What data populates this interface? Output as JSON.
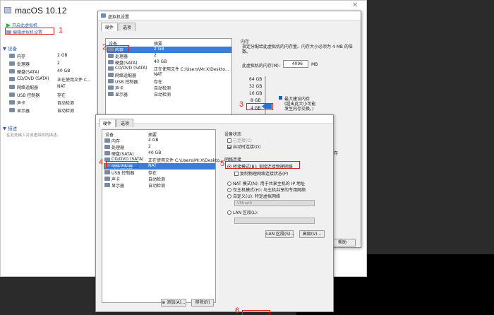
{
  "library": {
    "title": "macOS 10.12",
    "actions": [
      {
        "label": "开启此虚拟机",
        "icon": "play-icon"
      },
      {
        "label": "编辑虚拟机设置",
        "icon": "edit-icon"
      }
    ],
    "devices_header": "设备",
    "devices": [
      {
        "name": "内存",
        "value": "2 GB"
      },
      {
        "name": "处理器",
        "value": "2"
      },
      {
        "name": "硬盘(SATA)",
        "value": "40 GB"
      },
      {
        "name": "CD/DVD (SATA)",
        "value": "正在使用文件 C..."
      },
      {
        "name": "网络适配器",
        "value": "NAT"
      },
      {
        "name": "USB 控制器",
        "value": "存在"
      },
      {
        "name": "声卡",
        "value": "自动检测"
      },
      {
        "name": "显示器",
        "value": "自动检测"
      }
    ],
    "description_header": "描述",
    "description_placeholder": "在此处键入对该虚拟机的描述。"
  },
  "dialog1": {
    "title": "虚拟机设置",
    "tabs": [
      "硬件",
      "选项"
    ],
    "col_device": "设备",
    "col_summary": "摘要",
    "devices": [
      {
        "name": "内存",
        "value": "2 GB"
      },
      {
        "name": "处理器",
        "value": "2"
      },
      {
        "name": "硬盘(SATA)",
        "value": "40 GB"
      },
      {
        "name": "CD/DVD (SATA)",
        "value": "正在使用文件 C:\\Users\\Mr.X\\Deskto..."
      },
      {
        "name": "网络适配器",
        "value": "NAT"
      },
      {
        "name": "USB 控制器",
        "value": "存在"
      },
      {
        "name": "声卡",
        "value": "自动检测"
      },
      {
        "name": "显示器",
        "value": "自动检测"
      }
    ],
    "memory_group": "内存",
    "memory_desc": "指定分配给此虚拟机的内存量。内存大小必须为 4 MB 的倍数。",
    "memory_field_label": "此虚拟机的内存(M):",
    "memory_value": "4096",
    "memory_unit": "MB",
    "scale": [
      "64 GB",
      "32 GB",
      "16 GB",
      "8 GB",
      "4 GB"
    ],
    "max_label": "最大建议内存",
    "max_note": "(超出此大小可能发生内存交换。)",
    "partial_right": "出内存",
    "help_button": "帮助"
  },
  "dialog2": {
    "tabs": [
      "硬件",
      "选项"
    ],
    "col_device": "设备",
    "col_summary": "摘要",
    "devices": [
      {
        "name": "内存",
        "value": "4 GB"
      },
      {
        "name": "处理器",
        "value": "2"
      },
      {
        "name": "硬盘(SATA)",
        "value": "40 GB"
      },
      {
        "name": "CD/DVD (SATA)",
        "value": "正在使用文件 C:\\Users\\Mr.X\\Deskto..."
      },
      {
        "name": "网络适配器",
        "value": "NAT"
      },
      {
        "name": "USB 控制器",
        "value": "存在"
      },
      {
        "name": "声卡",
        "value": "自动检测"
      },
      {
        "name": "显示器",
        "value": "自动检测"
      }
    ],
    "device_status": "设备状态",
    "connected": "已连接(C)",
    "connect_on_power": "启动时连接(O)",
    "network_group": "网络连接",
    "bridged": "桥接模式(B): 直接连接物理网络",
    "replicate": "复制物理网络连接状态(P)",
    "nat": "NAT 模式(N): 用于共享主机的 IP 地址",
    "host_only": "仅主机模式(H): 与主机共享的专用网络",
    "custom": "自定义(U): 特定虚拟网络",
    "custom_select": "VMnet0",
    "lan": "LAN 区段(L):",
    "lan_button": "LAN 区段(S)...",
    "advanced_button": "高级(V)...",
    "add_button": "添加(A)...",
    "remove_button": "移除(R)"
  },
  "steps": [
    "1",
    "2",
    "3",
    "4",
    "5",
    "6"
  ]
}
